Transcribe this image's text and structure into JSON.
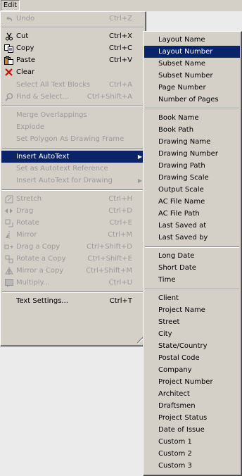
{
  "menubar": {
    "edit_label": "Edit"
  },
  "edit_menu": {
    "items": [
      {
        "label": "Undo",
        "shortcut": "Ctrl+Z",
        "icon": "undo-icon",
        "disabled": true
      },
      {
        "label": "Cut",
        "shortcut": "Ctrl+X",
        "icon": "scissors-icon",
        "disabled": false
      },
      {
        "label": "Copy",
        "shortcut": "Ctrl+C",
        "icon": "copy-icon",
        "disabled": false
      },
      {
        "label": "Paste",
        "shortcut": "Ctrl+V",
        "icon": "paste-icon",
        "disabled": false
      },
      {
        "label": "Clear",
        "shortcut": "",
        "icon": "clear-x-icon",
        "disabled": false
      },
      {
        "label": "Select All Text Blocks",
        "shortcut": "Ctrl+A",
        "icon": "",
        "disabled": true
      },
      {
        "label": "Find & Select...",
        "shortcut": "Ctrl+Shift+A",
        "icon": "find-select-icon",
        "disabled": true
      },
      {
        "label": "Merge Overlappings",
        "shortcut": "",
        "icon": "",
        "disabled": true
      },
      {
        "label": "Explode",
        "shortcut": "",
        "icon": "",
        "disabled": true
      },
      {
        "label": "Set Polygon As Drawing Frame",
        "shortcut": "",
        "icon": "",
        "disabled": true
      },
      {
        "label": "Insert AutoText",
        "shortcut": "",
        "icon": "",
        "disabled": false,
        "submenu": true,
        "selected": true
      },
      {
        "label": "Set as Autotext Reference",
        "shortcut": "",
        "icon": "",
        "disabled": true
      },
      {
        "label": "Insert AutoText for Drawing",
        "shortcut": "",
        "icon": "",
        "disabled": true,
        "submenu": true
      },
      {
        "label": "Stretch",
        "shortcut": "Ctrl+H",
        "icon": "stretch-icon",
        "disabled": true
      },
      {
        "label": "Drag",
        "shortcut": "Ctrl+D",
        "icon": "drag-icon",
        "disabled": true
      },
      {
        "label": "Rotate",
        "shortcut": "Ctrl+E",
        "icon": "rotate-icon",
        "disabled": true
      },
      {
        "label": "Mirror",
        "shortcut": "Ctrl+M",
        "icon": "mirror-icon",
        "disabled": true
      },
      {
        "label": "Drag a Copy",
        "shortcut": "Ctrl+Shift+D",
        "icon": "drag-copy-icon",
        "disabled": true
      },
      {
        "label": "Rotate a Copy",
        "shortcut": "Ctrl+Shift+E",
        "icon": "rotate-copy-icon",
        "disabled": true
      },
      {
        "label": "Mirror a Copy",
        "shortcut": "Ctrl+Shift+M",
        "icon": "mirror-copy-icon",
        "disabled": true
      },
      {
        "label": "Multiply...",
        "shortcut": "Ctrl+U",
        "icon": "multiply-icon",
        "disabled": true
      },
      {
        "label": "Text Settings...",
        "shortcut": "Ctrl+T",
        "icon": "",
        "disabled": false
      }
    ]
  },
  "autotext_submenu": {
    "items": [
      "Layout Name",
      "Layout Number",
      "Subset Name",
      "Subset Number",
      "Page Number",
      "Number of Pages",
      "Book Name",
      "Book Path",
      "Drawing Name",
      "Drawing Number",
      "Drawing Path",
      "Drawing Scale",
      "Output Scale",
      "AC File Name",
      "AC File Path",
      "Last Saved at",
      "Last Saved by",
      "Long Date",
      "Short Date",
      "Time",
      "Client",
      "Project Name",
      "Street",
      "City",
      "State/Country",
      "Postal Code",
      "Company",
      "Project Number",
      "Architect",
      "Draftsmen",
      "Project Status",
      "Date of Issue",
      "Custom 1",
      "Custom 2",
      "Custom 3"
    ],
    "selected": "Layout Number"
  },
  "colors": {
    "menu_bg": "#d4d0c8",
    "highlight": "#0a246a",
    "disabled_text": "#9a9a9a",
    "desktop": "#ecebeb"
  }
}
